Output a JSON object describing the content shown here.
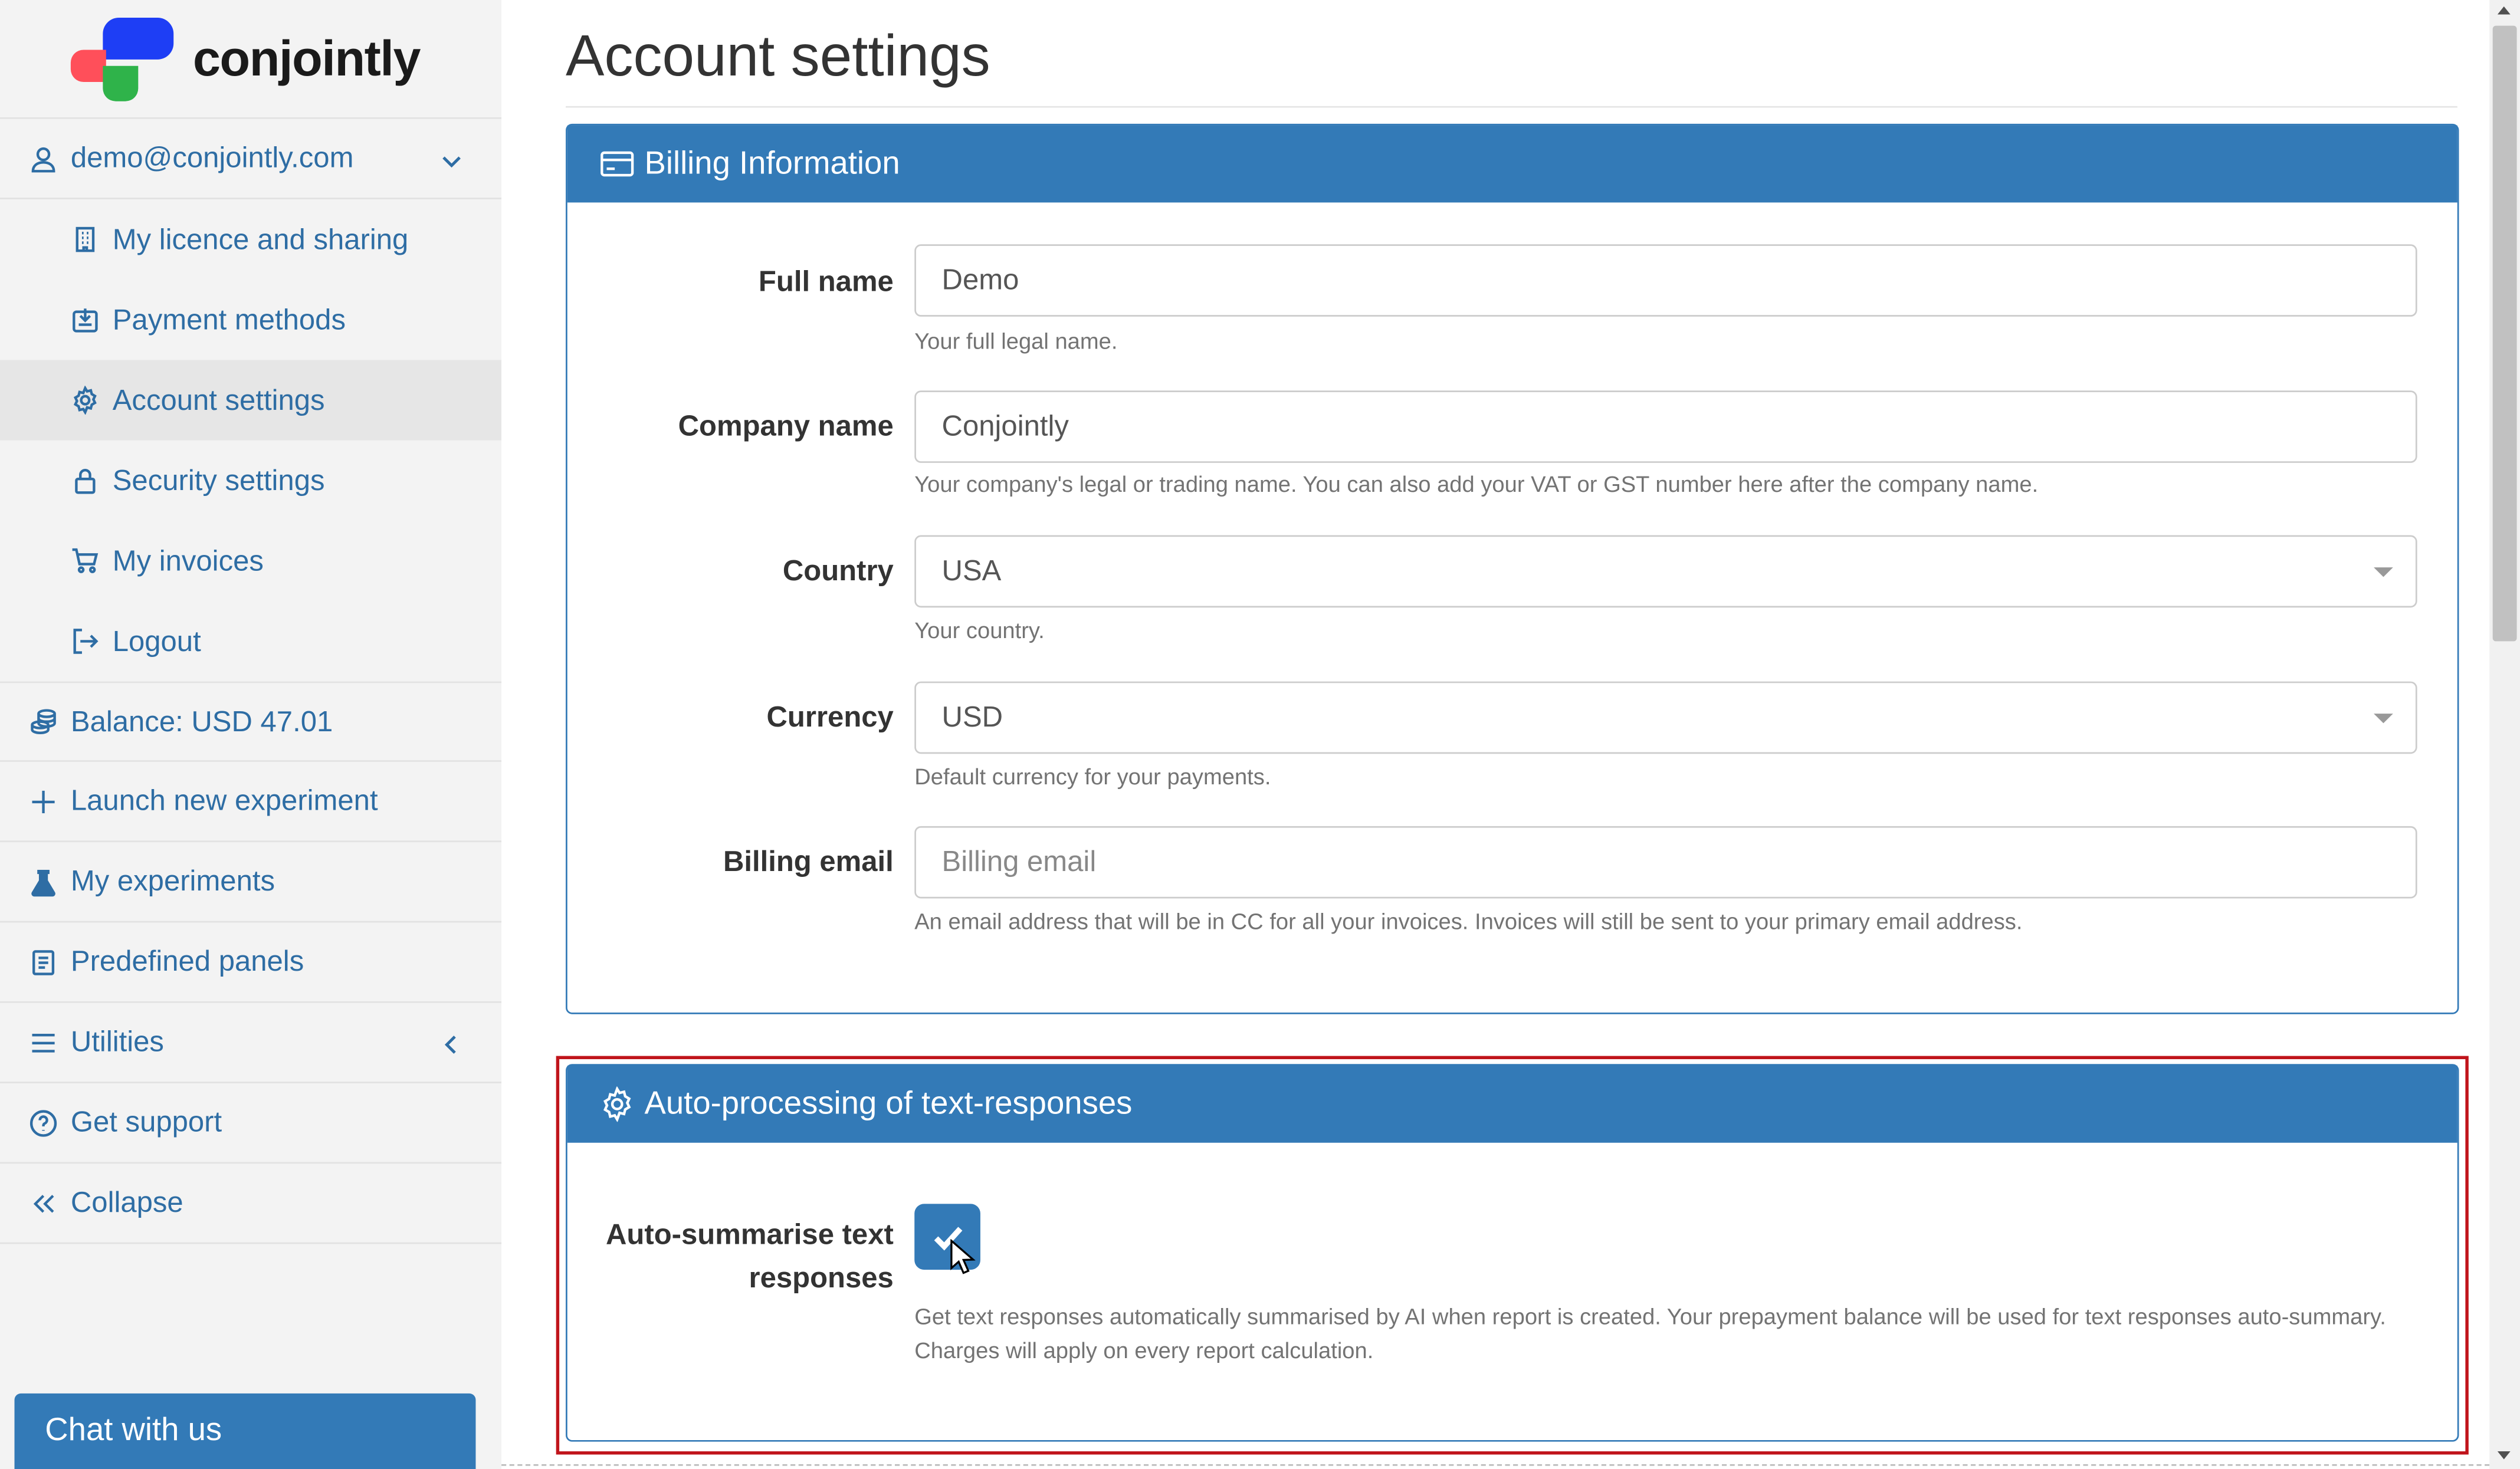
{
  "brand": {
    "name": "conjointly"
  },
  "sidebar": {
    "account": {
      "label": "demo@conjointly.com"
    },
    "items": [
      {
        "label": "My licence and sharing",
        "icon": "building-icon"
      },
      {
        "label": "Payment methods",
        "icon": "payment-icon"
      },
      {
        "label": "Account settings",
        "icon": "gear-icon"
      },
      {
        "label": "Security settings",
        "icon": "lock-icon"
      },
      {
        "label": "My invoices",
        "icon": "cart-icon"
      },
      {
        "label": "Logout",
        "icon": "logout-icon"
      }
    ],
    "balance": {
      "label": "Balance: USD 47.01",
      "icon": "coins-icon"
    },
    "launch": {
      "label": "Launch new experiment",
      "icon": "plus-icon"
    },
    "experiments": {
      "label": "My experiments",
      "icon": "flask-icon"
    },
    "panels": {
      "label": "Predefined panels",
      "icon": "book-icon"
    },
    "utilities": {
      "label": "Utilities",
      "icon": "menu-icon"
    },
    "support": {
      "label": "Get support",
      "icon": "question-icon"
    },
    "collapse": {
      "label": "Collapse",
      "icon": "double-chevron-left-icon"
    },
    "chat": {
      "label": "Chat with us"
    }
  },
  "main": {
    "title": "Account settings",
    "billing": {
      "heading": "Billing Information",
      "full_name": {
        "label": "Full name",
        "value": "Demo",
        "help": "Your full legal name."
      },
      "company_name": {
        "label": "Company name",
        "value": "Conjointly",
        "help": "Your company's legal or trading name. You can also add your VAT or GST number here after the company name."
      },
      "country": {
        "label": "Country",
        "value": "USA",
        "help": "Your country."
      },
      "currency": {
        "label": "Currency",
        "value": "USD",
        "help": "Default currency for your payments."
      },
      "billing_email": {
        "label": "Billing email",
        "placeholder": "Billing email",
        "help": "An email address that will be in CC for all your invoices. Invoices will still be sent to your primary email address."
      }
    },
    "autoproc": {
      "heading": "Auto-processing of text-responses",
      "summarise": {
        "label_line1": "Auto-summarise text",
        "label_line2": "responses",
        "checked": true,
        "help_line1": "Get text responses automatically summarised by AI when report is created. Your prepayment balance will be used for text responses auto-summary.",
        "help_line2": "Charges will apply on every report calculation."
      }
    }
  },
  "colors": {
    "primary": "#337ab7",
    "highlight": "#c0141b",
    "sidebar_bg": "#f3f3f3",
    "link": "#2e6da4"
  }
}
